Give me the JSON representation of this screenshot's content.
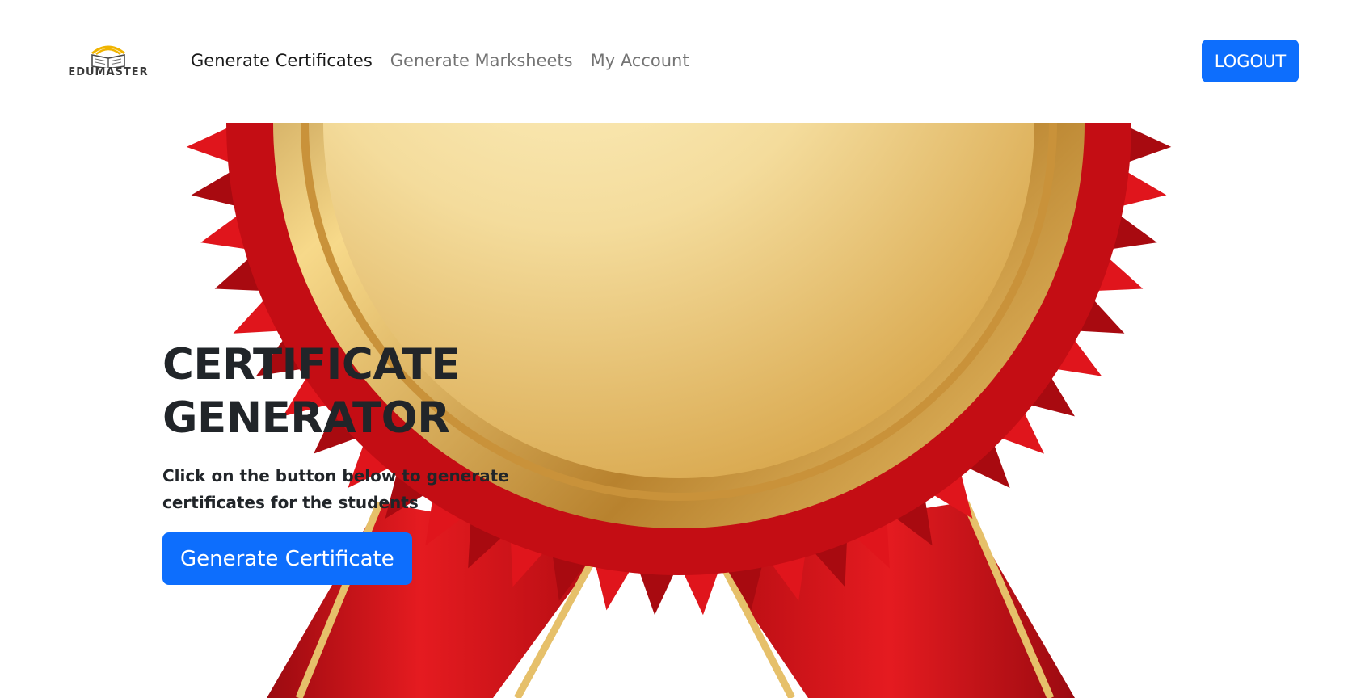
{
  "brand": {
    "name": "EDUMASTER",
    "icon": "book-wifi-logo"
  },
  "nav": {
    "links": [
      {
        "label": "Generate Certificates",
        "active": true
      },
      {
        "label": "Generate Marksheets",
        "active": false
      },
      {
        "label": "My Account",
        "active": false
      }
    ],
    "logout_label": "LOGOUT"
  },
  "hero": {
    "title_line1": "CERTIFICATE",
    "title_line2": "GENERATOR",
    "subtitle": "Click on the button below to generate certificates for the students",
    "button_label": "Generate Certificate",
    "background_image": "gold-medal-red-ribbon"
  },
  "colors": {
    "primary": "#0d6efd",
    "text": "#212529",
    "ribbon_red": "#d9101a",
    "medal_gold": "#e8c876"
  }
}
